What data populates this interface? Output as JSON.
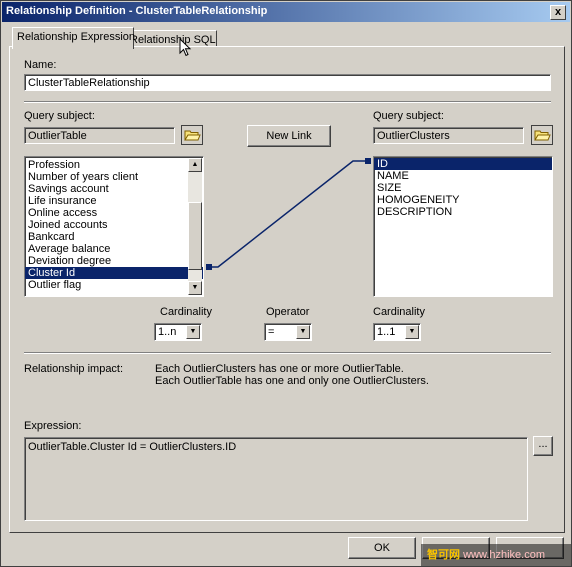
{
  "window": {
    "title": "Relationship Definition - ClusterTableRelationship",
    "close_glyph": "x"
  },
  "tabs": [
    {
      "label": "Relationship Expression",
      "active": true
    },
    {
      "label": "Relationship SQL",
      "active": false
    }
  ],
  "name": {
    "label": "Name:",
    "value": "ClusterTableRelationship"
  },
  "left": {
    "query_subject_label": "Query subject:",
    "query_subject": "OutlierTable",
    "items": [
      "Profession",
      "Number of years client",
      "Savings account",
      "Life insurance",
      "Online access",
      "Joined accounts",
      "Bankcard",
      "Average balance",
      "Deviation degree",
      "Cluster Id",
      "Outlier flag"
    ],
    "selected_index": 9
  },
  "new_link_label": "New Link",
  "right": {
    "query_subject_label": "Query subject:",
    "query_subject": "OutlierClusters",
    "items": [
      "ID",
      "NAME",
      "SIZE",
      "HOMOGENEITY",
      "DESCRIPTION"
    ],
    "selected_index": 0
  },
  "cardinality_left": {
    "label": "Cardinality",
    "value": "1..n"
  },
  "operator": {
    "label": "Operator",
    "value": "="
  },
  "cardinality_right": {
    "label": "Cardinality",
    "value": "1..1"
  },
  "impact": {
    "label": "Relationship impact:",
    "line1": "Each OutlierClusters has one or more OutlierTable.",
    "line2": "Each OutlierTable has one and only one OutlierClusters."
  },
  "expression": {
    "label": "Expression:",
    "value": "OutlierTable.Cluster Id = OutlierClusters.ID",
    "browse_label": "..."
  },
  "buttons": {
    "ok": "OK"
  },
  "watermark": {
    "logo": "智可网",
    "url": "www.hzhike.com"
  },
  "colors": {
    "selection": "#0a246a",
    "face": "#d4d0c8",
    "link_line": "#0a246a"
  }
}
